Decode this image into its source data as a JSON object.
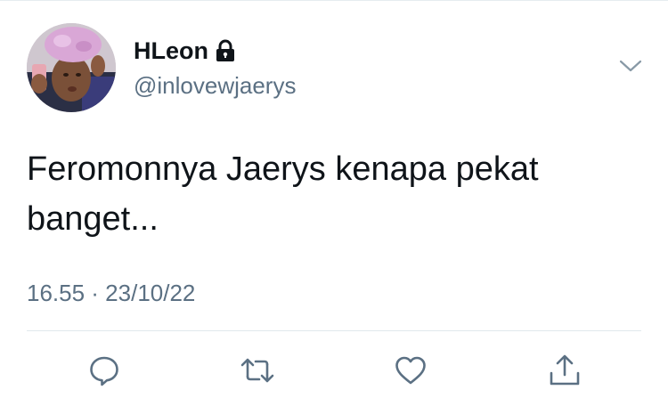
{
  "tweet": {
    "author": {
      "display_name": "HLeon",
      "handle": "@inlovewjaerys",
      "protected_icon": "lock-icon",
      "avatar": "avatar"
    },
    "menu_icon": "chevron-down-icon",
    "text": "Feromonnya Jaerys kenapa pekat banget...",
    "timestamp": "16.55 · 23/10/22",
    "actions": {
      "reply": "reply-icon",
      "retweet": "retweet-icon",
      "like": "heart-icon",
      "share": "share-icon"
    }
  },
  "colors": {
    "primary_text": "#0f1419",
    "secondary_text": "#5b7083",
    "icon": "#5b7083",
    "divider": "#e1e8ed"
  }
}
